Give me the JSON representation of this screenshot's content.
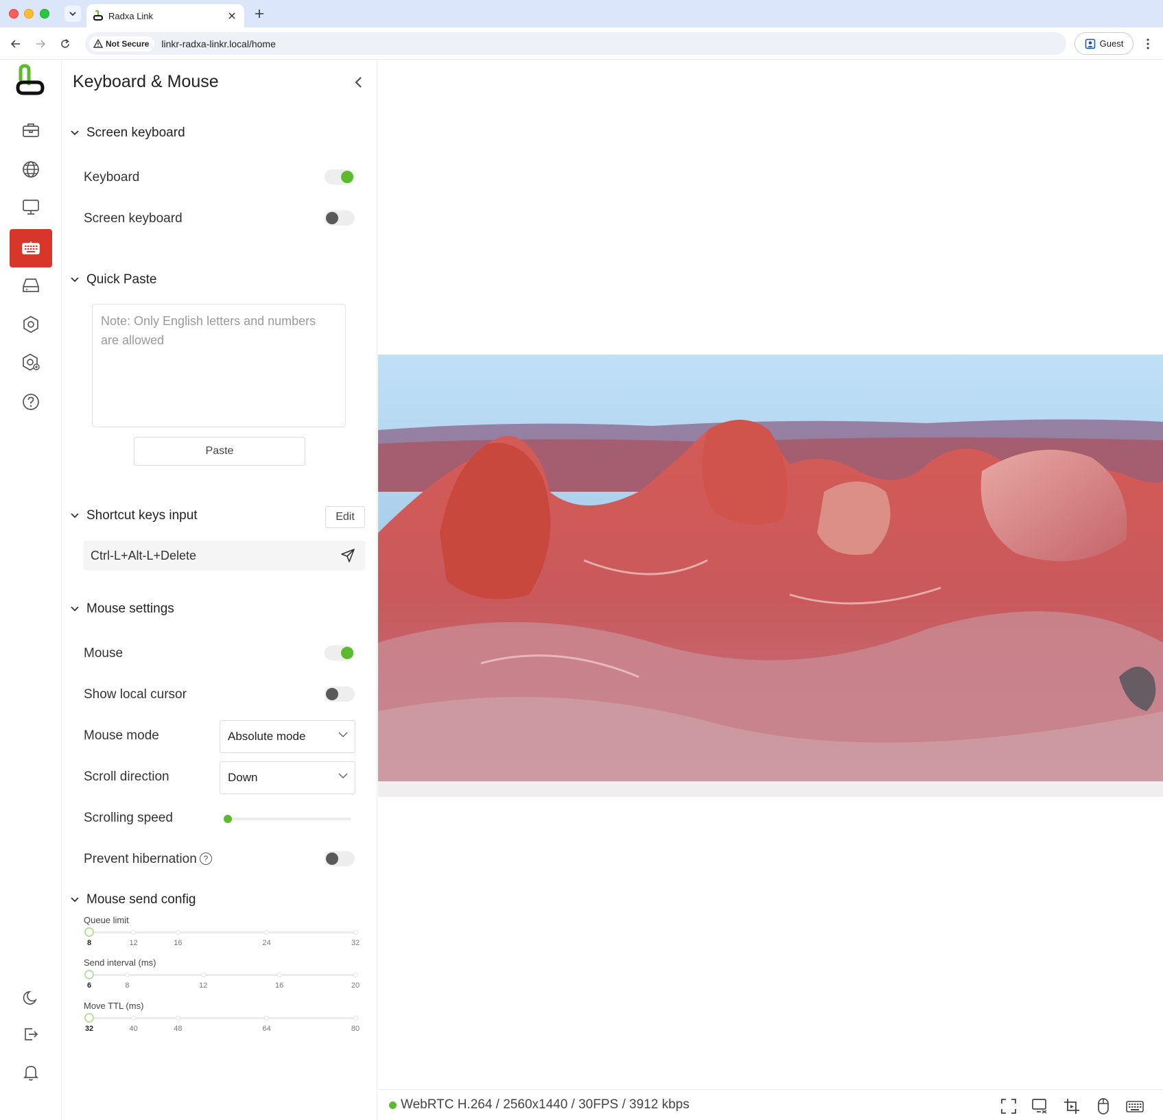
{
  "browser": {
    "tab_title": "Radxa Link",
    "security_label": "Not Secure",
    "url": "linkr-radxa-linkr.local/home",
    "profile_label": "Guest"
  },
  "panel": {
    "title": "Keyboard & Mouse",
    "sections": {
      "screen_keyboard": {
        "title": "Screen keyboard",
        "keyboard_label": "Keyboard",
        "keyboard_on": true,
        "screen_keyboard_label": "Screen keyboard",
        "screen_keyboard_on": false
      },
      "quick_paste": {
        "title": "Quick Paste",
        "placeholder": "Note: Only English letters and numbers are allowed",
        "value": "",
        "paste_label": "Paste"
      },
      "shortcut_keys": {
        "title": "Shortcut keys input",
        "edit_label": "Edit",
        "combo": "Ctrl-L+Alt-L+Delete"
      },
      "mouse_settings": {
        "title": "Mouse settings",
        "mouse_label": "Mouse",
        "mouse_on": true,
        "local_cursor_label": "Show local cursor",
        "local_cursor_on": false,
        "mode_label": "Mouse mode",
        "mode_value": "Absolute mode",
        "scroll_dir_label": "Scroll direction",
        "scroll_dir_value": "Down",
        "scroll_speed_label": "Scrolling speed",
        "scroll_speed_fraction": 0.0,
        "hibernation_label": "Prevent hibernation",
        "hibernation_on": false
      },
      "mouse_send_config": {
        "title": "Mouse send config",
        "queue_limit": {
          "label": "Queue limit",
          "ticks": [
            "8",
            "12",
            "16",
            "24",
            "32"
          ],
          "value": 8
        },
        "send_interval": {
          "label": "Send interval (ms)",
          "ticks": [
            "6",
            "8",
            "12",
            "16",
            "20"
          ],
          "value": 6
        },
        "move_ttl": {
          "label": "Move TTL (ms)",
          "ticks": [
            "32",
            "40",
            "48",
            "64",
            "80"
          ],
          "value": 32
        }
      }
    }
  },
  "rail": {
    "items": [
      "briefcase-icon",
      "globe-icon",
      "monitor-icon",
      "keyboard-icon",
      "storage-icon",
      "settings-icon",
      "advanced-settings-icon",
      "help-icon"
    ],
    "active": "keyboard-icon",
    "bottom": [
      "dark-mode-icon",
      "logout-icon",
      "notifications-icon"
    ]
  },
  "status_bar": {
    "stream_info": "WebRTC H.264 / 2560x1440 / 30FPS / 3912 kbps",
    "connected": true
  },
  "colors": {
    "accent_green": "#5cbb2c",
    "active_rail": "#d8362b"
  }
}
